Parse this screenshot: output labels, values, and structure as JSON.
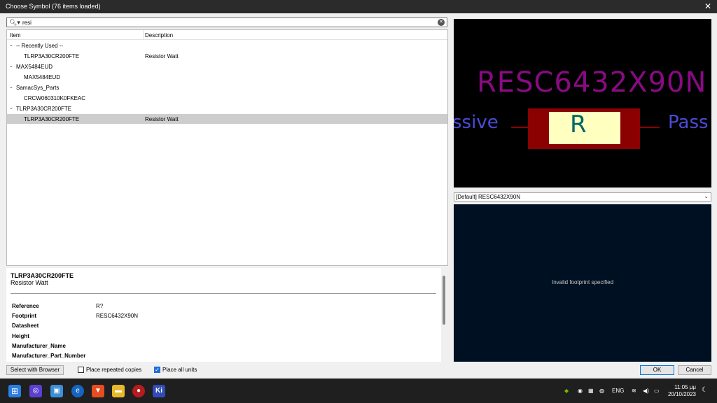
{
  "window": {
    "title": "Choose Symbol (76 items loaded)",
    "close_glyph": "✕"
  },
  "search": {
    "value": "resi",
    "placeholder": "",
    "icon": "search-icon",
    "clear_glyph": "✕"
  },
  "tree": {
    "columns": {
      "item": "Item",
      "description": "Description"
    },
    "rows": [
      {
        "label": "-- Recently Used --",
        "desc": "",
        "level": 0,
        "expanded": true
      },
      {
        "label": "TLRP3A30CR200FTE",
        "desc": "Resistor Watt",
        "level": 1
      },
      {
        "label": "MAX5484EUD",
        "desc": "",
        "level": 0,
        "expanded": true
      },
      {
        "label": "MAX5484EUD",
        "desc": "",
        "level": 1
      },
      {
        "label": "SamacSys_Parts",
        "desc": "",
        "level": 0,
        "expanded": true
      },
      {
        "label": "CRCW060310K0FKEAC",
        "desc": "",
        "level": 1
      },
      {
        "label": "TLRP3A30CR200FTE",
        "desc": "",
        "level": 0,
        "expanded": true
      },
      {
        "label": "TLRP3A30CR200FTE",
        "desc": "Resistor Watt",
        "level": 1,
        "selected": true
      }
    ]
  },
  "details": {
    "name": "TLRP3A30CR200FTE",
    "description": "Resistor Watt",
    "fields": [
      {
        "key": "Reference",
        "value": "R?"
      },
      {
        "key": "Footprint",
        "value": "RESC6432X90N"
      },
      {
        "key": "Datasheet",
        "value": ""
      },
      {
        "key": "Height",
        "value": ""
      },
      {
        "key": "Manufacturer_Name",
        "value": ""
      },
      {
        "key": "Manufacturer_Part_Number",
        "value": ""
      }
    ]
  },
  "bottom": {
    "select_browser": "Select with Browser",
    "place_repeated": {
      "label": "Place repeated copies",
      "checked": false
    },
    "place_all_units": {
      "label": "Place all units",
      "checked": true
    },
    "ok": "OK",
    "cancel": "Cancel"
  },
  "symbol_preview": {
    "value_text": "RESC6432X90N",
    "pin_left_text": "ssive",
    "pin_right_text": "Pass",
    "reference_text": "R",
    "colors": {
      "background": "#000000",
      "value": "#8a0a84",
      "pin": "#4b4bd6",
      "body": "#8b0000",
      "body_fill": "#ffffc0",
      "reference": "#006666"
    }
  },
  "footprint": {
    "selected": "[Default] RESC6432X90N",
    "message": "Invalid footprint specified",
    "background": "#001023"
  },
  "taskbar": {
    "icons": [
      "windows-start-icon",
      "app-icon",
      "app-icon",
      "edge-icon",
      "brave-icon",
      "file-explorer-icon",
      "app-icon",
      "kicad-icon"
    ],
    "kicad_label": "Ki",
    "language": "ENG",
    "time": "11:05 μμ",
    "date": "20/10/2023"
  }
}
